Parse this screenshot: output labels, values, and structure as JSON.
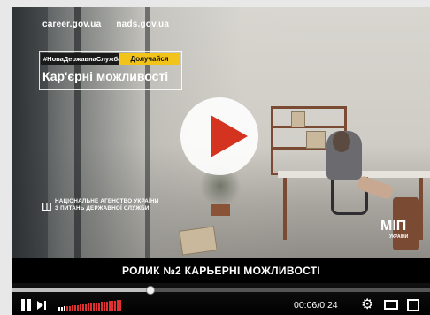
{
  "video": {
    "sites": [
      "career.gov.ua",
      "nads.gov.ua"
    ],
    "hashtag": "#НоваДержавнаСлужба",
    "join_label": "Долучайся",
    "headline": "Кар'єрні можливості",
    "agency_line1": "НАЦІОНАЛЬНЕ АГЕНСТВО УКРАЇНИ",
    "agency_line2": "З ПИТАНЬ ДЕРЖАВНОЇ СЛУЖБИ",
    "ministry_logo": "МІП",
    "ministry_sub": "УКРАЇНИ",
    "caption": "РОЛИК №2 КАРЬЕРНІ МОЖЛИВОСТІ"
  },
  "controls": {
    "time_display": "00:06/0:24",
    "progress_fraction": 0.33,
    "volume_fraction": 1.0,
    "icons": [
      "pause-icon",
      "next-icon",
      "volume-icon",
      "settings-icon",
      "theater-icon",
      "fullscreen-icon"
    ]
  },
  "colors": {
    "play_accent": "#d3331f",
    "join_badge": "#f2c318",
    "volume_active": "#e03030"
  }
}
